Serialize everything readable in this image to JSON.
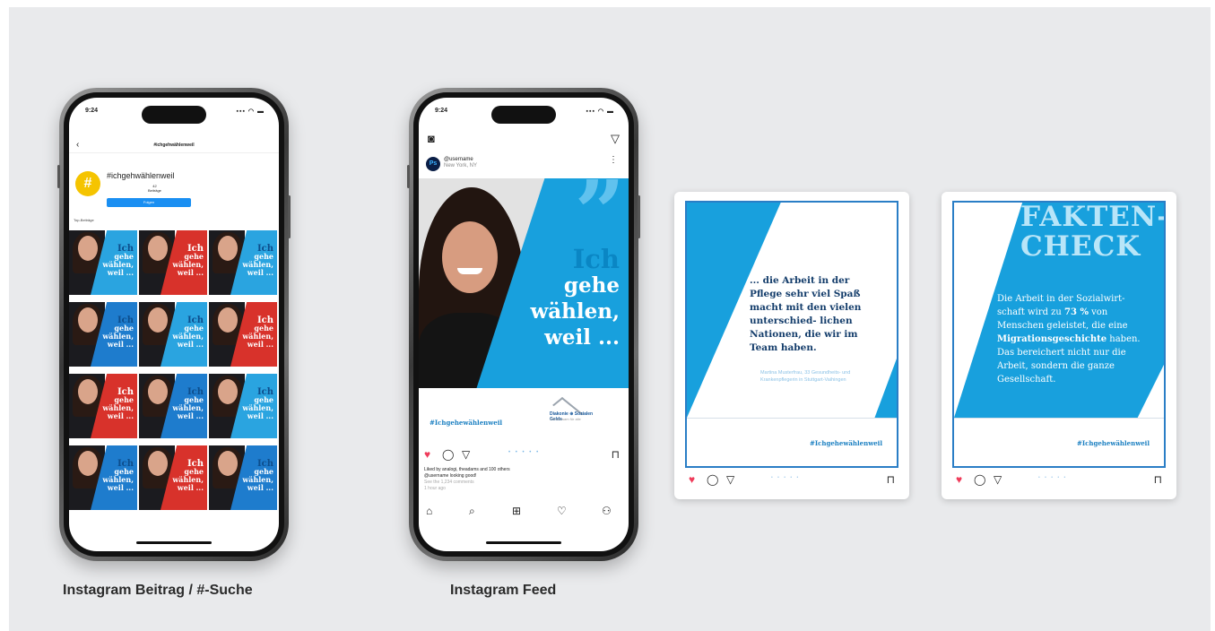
{
  "captions": {
    "left": "Instagram Beitrag / #-Suche",
    "middle": "Instagram Feed"
  },
  "phone1": {
    "time": "9:24",
    "signal": "▪▪▪ ◠ ▬",
    "header_title": "#ichgehwählenweil",
    "back_icon": "chevron-left-icon",
    "avatar_symbol": "#",
    "hashtag": "#ichgehwählenweil",
    "posts_count": "42",
    "posts_label": "Beiträge",
    "follow_label": "Folgen",
    "top_label": "Top-Beiträge",
    "tile_line1": "Ich",
    "tile_line2": "gehe",
    "tile_line3": "wählen,",
    "tile_line4": "weil ..."
  },
  "phone2": {
    "time": "9:24",
    "signal": "▪▪▪ ◠ ▬",
    "camera_icon": "camera-icon",
    "direct_icon": "send-icon",
    "avatar": "Ps",
    "username": "@username",
    "location": "New York, NY",
    "more": "⋮",
    "post_ich": "Ich",
    "post_line2": "gehe",
    "post_line3": "wählen,",
    "post_line4": "weil ...",
    "post_quote": "”",
    "post_hashtag": "#Ichgehewählenweil",
    "logo_line1": "Diakonie ⊕ Sozialen Gelds",
    "logo_line2": "Gemeinsam für alle",
    "likes": "Liked by analogi, theadams  and  100 others",
    "caption_line": "@username  looking good!",
    "comments": "See the 1,234 comments",
    "time_ago": "1 hour ago",
    "dots": "• • • • •"
  },
  "card_quote": {
    "text": "... die Arbeit in der Pflege sehr viel Spaß macht mit den vielen unterschied- lichen Nationen, die wir im Team haben.",
    "author": "Martina Musterfrau, 33 Gesundheits- und Krankenpflegerin in Stuttgart-Vaihingen",
    "hashtag": "#Ichgehewählenweil",
    "dots": "• • • • •"
  },
  "card_fact": {
    "title1": "FAKTEN-",
    "title2": "CHECK",
    "text_a": "Die Arbeit in der Sozialwirt- schaft wird zu ",
    "text_b": "73 %",
    "text_c": " von Menschen geleistet, die eine ",
    "text_d": "Migrationsgeschichte",
    "text_e": " haben. Das bereichert nicht nur die Arbeit, sondern die ganze Gesellschaft.",
    "hashtag": "#Ichgehewählenweil",
    "dots": "• • • • •"
  },
  "icons": {
    "heart": "♥",
    "comment": "◯",
    "share": "▽",
    "save": "⊓",
    "home": "⌂",
    "search": "⌕",
    "add": "⊞",
    "activity": "♡",
    "profile": "⚇"
  },
  "colors": {
    "accent_blue": "#18a0dd",
    "dark_blue": "#143d6b",
    "accent_red": "#e0312e",
    "heart": "#ef3b5a",
    "background": "#e9eaec"
  }
}
